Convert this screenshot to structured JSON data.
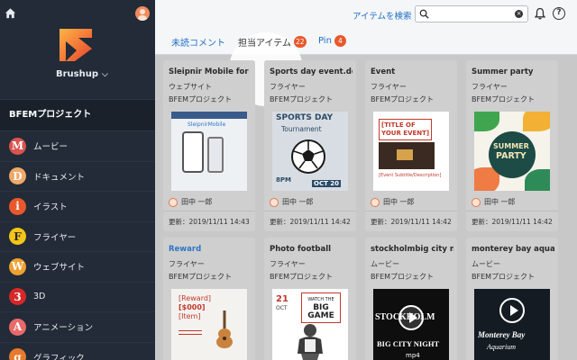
{
  "sidebar": {
    "brand_name": "Brushup",
    "project_header": "BFEMプロジェクト",
    "categories": [
      {
        "letter": "M",
        "label": "ムービー",
        "color": "#d9534f",
        "text_color": "#ffffff"
      },
      {
        "letter": "D",
        "label": "ドキュメント",
        "color": "#f0a868",
        "text_color": "#ffffff"
      },
      {
        "letter": "i",
        "label": "イラスト",
        "color": "#e8582c",
        "text_color": "#ffffff"
      },
      {
        "letter": "F",
        "label": "フライヤー",
        "color": "#f5c518",
        "text_color": "#2a2a2a"
      },
      {
        "letter": "W",
        "label": "ウェブサイト",
        "color": "#f0a030",
        "text_color": "#ffffff"
      },
      {
        "letter": "3",
        "label": "3D",
        "color": "#d62828",
        "text_color": "#ffffff"
      },
      {
        "letter": "A",
        "label": "アニメーション",
        "color": "#e86a6a",
        "text_color": "#ffffff"
      },
      {
        "letter": "g",
        "label": "グラフィック",
        "color": "#e87a2c",
        "text_color": "#ffffff"
      }
    ]
  },
  "topbar": {
    "search_link": "アイテムを検索",
    "search_value": "",
    "search_placeholder": ""
  },
  "tabs": [
    {
      "label": "未読コメント",
      "count": ""
    },
    {
      "label": "担当アイテム",
      "count": "22"
    },
    {
      "label": "Pin",
      "count": "4"
    }
  ],
  "cards": [
    {
      "title": "Sleipnir Mobile for i...",
      "type": "ウェブサイト",
      "project": "BFEMプロジェクト",
      "owner": "田中 一郎",
      "updated": "更新：2019/11/11 14:43",
      "thumb_text": "SleipnirMobile"
    },
    {
      "title": "Sports day event.docx",
      "type": "フライヤー",
      "project": "BFEMプロジェクト",
      "owner": "田中 一郎",
      "updated": "更新：2019/11/11 14:42",
      "thumb_text": [
        "SPORTS DAY",
        "Tournament",
        "8PM",
        "OCT 20"
      ]
    },
    {
      "title": "Event",
      "type": "フライヤー",
      "project": "BFEMプロジェクト",
      "owner": "田中 一郎",
      "updated": "更新：2019/11/11 14:42",
      "thumb_text": [
        "[TITLE OF",
        "YOUR EVENT]",
        "[Event Subtitle/Description]"
      ]
    },
    {
      "title": "Summer party",
      "type": "フライヤー",
      "project": "BFEMプロジェクト",
      "owner": "田中 一郎",
      "updated": "更新：2019/11/11 14:42",
      "thumb_text": [
        "SUMMER",
        "PARTY"
      ]
    },
    {
      "title": "Reward",
      "type": "フライヤー",
      "project": "BFEMプロジェクト",
      "thumb_text": [
        "[Reward]",
        "[$000]",
        "[Item]"
      ]
    },
    {
      "title": "Photo football",
      "type": "フライヤー",
      "project": "BFEMプロジェクト",
      "thumb_text": [
        "21",
        "OCT",
        "WATCH THE",
        "BIG",
        "GAME"
      ]
    },
    {
      "title": "stockholmbig city ni...",
      "type": "ムービー",
      "project": "BFEMプロジェクト",
      "thumb_text": [
        "STOCKHOLM",
        "BIG CITY NIGHT",
        "mp4"
      ]
    },
    {
      "title": "monterey bay aquar...",
      "type": "ムービー",
      "project": "BFEMプロジェクト",
      "thumb_text": [
        "Monterey Bay",
        "Aquarium"
      ]
    }
  ]
}
